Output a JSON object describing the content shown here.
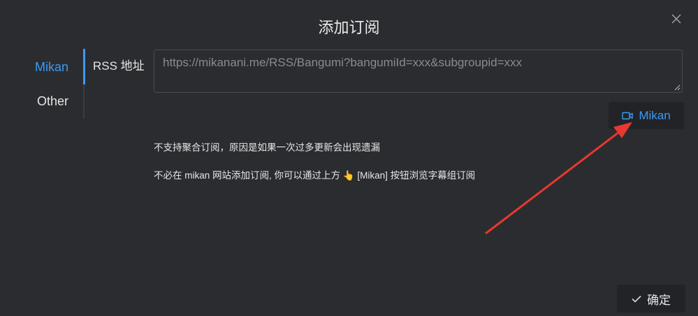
{
  "dialog": {
    "title": "添加订阅",
    "close_icon": "close-icon"
  },
  "tabs": [
    {
      "label": "Mikan",
      "active": true
    },
    {
      "label": "Other",
      "active": false
    }
  ],
  "form": {
    "rss_label": "RSS 地址",
    "rss_value": "",
    "rss_placeholder": "https://mikanani.me/RSS/Bangumi?bangumiId=xxx&subgroupid=xxx"
  },
  "mikan_button": {
    "label": "Mikan",
    "icon": "video-camera-icon"
  },
  "tips": {
    "line1": "不支持聚合订阅，原因是如果一次过多更新会出现遗漏",
    "line2_prefix": "不必在 mikan 网站添加订阅, 你可以通过上方",
    "line2_emoji": "👆",
    "line2_suffix": "[Mikan] 按钮浏览字幕组订阅"
  },
  "confirm_button": {
    "label": "确定",
    "icon": "check-icon"
  },
  "colors": {
    "accent": "#3a9bf5",
    "background": "#2b2c30",
    "annotation_arrow": "#e8382f"
  }
}
